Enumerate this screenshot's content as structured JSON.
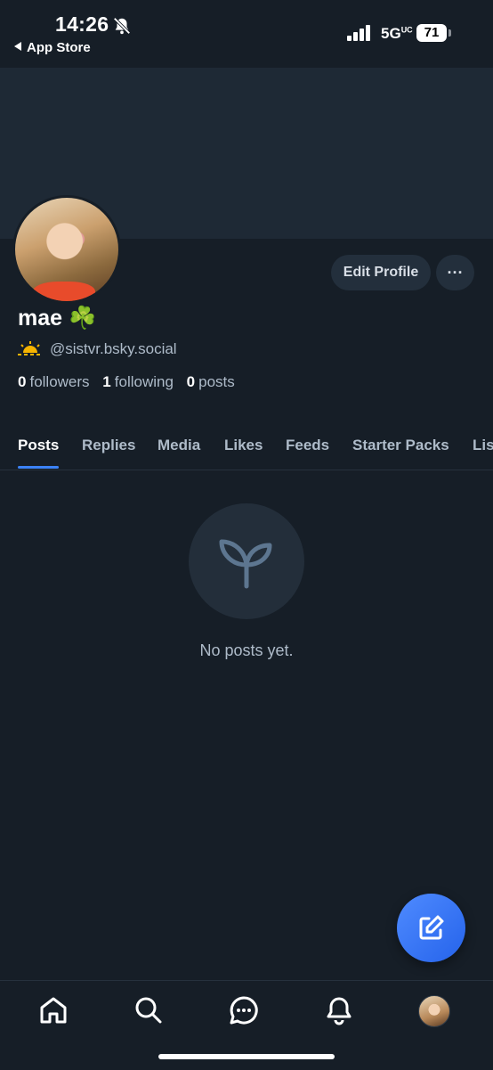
{
  "status_bar": {
    "time": "14:26",
    "back_label": "App Store",
    "network": "5G",
    "network_suffix": "UC",
    "battery": "71"
  },
  "profile": {
    "display_name": "mae ☘️",
    "handle": "@sistvr.bsky.social",
    "stats": {
      "followers_count": "0",
      "followers_label": "followers",
      "following_count": "1",
      "following_label": "following",
      "posts_count": "0",
      "posts_label": "posts"
    },
    "edit_button": "Edit Profile",
    "more_button": "···"
  },
  "tabs": [
    "Posts",
    "Replies",
    "Media",
    "Likes",
    "Feeds",
    "Starter Packs",
    "Lists"
  ],
  "active_tab": "Posts",
  "empty_state": {
    "icon": "seedling-icon",
    "text": "No posts yet."
  },
  "bottom_nav": [
    "home-icon",
    "search-icon",
    "chat-icon",
    "bell-icon",
    "profile-avatar"
  ],
  "colors": {
    "background": "#161e27",
    "banner": "#1e2935",
    "accent": "#3b82f6",
    "muted_text": "#aebbc9"
  }
}
